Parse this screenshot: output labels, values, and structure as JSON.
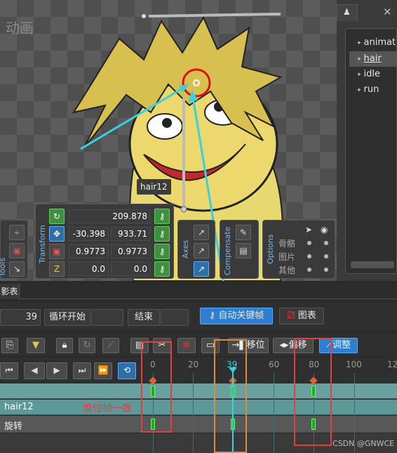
{
  "viewport": {
    "title": "动画",
    "bone_label": "hair12"
  },
  "right_panel": {
    "items": [
      {
        "label": "animat",
        "selected": false
      },
      {
        "label": "hair",
        "selected": true
      },
      {
        "label": "idle",
        "selected": false
      },
      {
        "label": "run",
        "selected": false
      }
    ]
  },
  "tools": {
    "label": "Tools"
  },
  "transform": {
    "label": "Transform",
    "rotate": "209.878",
    "translate_x": "-30.398",
    "translate_y": "933.71",
    "scale_x": "0.9773",
    "scale_y": "0.9773",
    "shear_x": "0.0",
    "shear_y": "0.0"
  },
  "axes": {
    "label": "Axes"
  },
  "compensate": {
    "label": "Compensate"
  },
  "options": {
    "label": "Options",
    "rows": [
      "骨骼",
      "图片",
      "其他"
    ]
  },
  "bottom": {
    "tab_label": "影表",
    "frame": "39",
    "loop_start": "循环开始",
    "end": "结束",
    "auto_key": "自动关键帧",
    "graph": "图表",
    "move_to": "移位",
    "offset": "偏移",
    "adjust": "调整",
    "ruler": [
      "0",
      "20",
      "39",
      "60",
      "80",
      "100",
      "12"
    ],
    "tracks": [
      "hair12",
      "旋转"
    ],
    "annotation": "首位帧一致",
    "watermark": "CSDN @GNWCE"
  },
  "colors": {
    "accent": "#2f7fd0",
    "keyframe": "#22aa22",
    "annotation": "#e04040",
    "playhead": "#3ad0e0"
  }
}
